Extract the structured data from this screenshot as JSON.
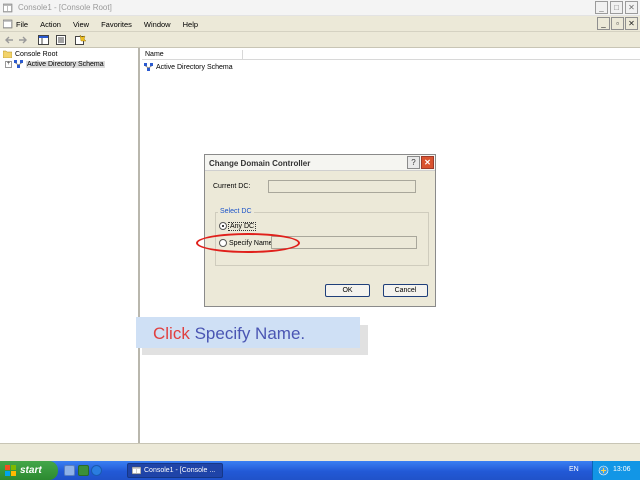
{
  "window": {
    "title": "Console1 - [Console Root]",
    "min_glyph": "_",
    "max_glyph": "□",
    "close_glyph": "✕"
  },
  "menu": {
    "items": [
      "File",
      "Action",
      "View",
      "Favorites",
      "Window",
      "Help"
    ],
    "child_min": "_",
    "child_restore": "▫",
    "child_close": "✕"
  },
  "tree": {
    "root": "Console Root",
    "child": "Active Directory Schema",
    "expander": "+"
  },
  "list": {
    "column_name": "Name",
    "items": [
      "Active Directory Schema"
    ]
  },
  "dialog": {
    "title": "Change Domain Controller",
    "help_glyph": "?",
    "close_glyph": "✕",
    "current_dc_label": "Current DC:",
    "current_dc_value": "",
    "group_title": "Select DC",
    "any_dc_label": "Any DC",
    "specify_name_label": "Specify Name",
    "specify_name_value": "",
    "ok_label": "OK",
    "cancel_label": "Cancel"
  },
  "callout": {
    "word1": "Click",
    "word2": "Specify Name."
  },
  "taskbar": {
    "start_label": "start",
    "task_label": "Console1 - [Console ...",
    "language": "EN",
    "clock": "13:06"
  },
  "colors": {
    "accent_blue": "#2259d6",
    "start_green": "#2c8a30",
    "highlight_red": "#e0201b",
    "callout_bg": "#cfe0f5"
  }
}
